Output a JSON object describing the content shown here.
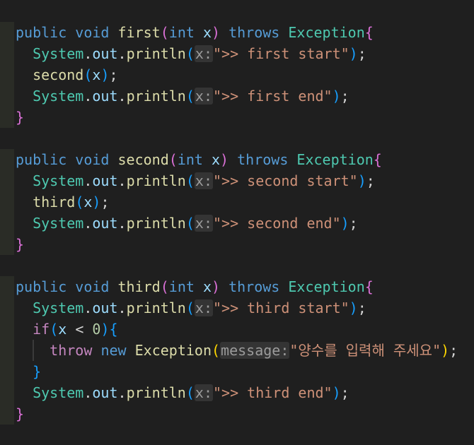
{
  "colors": {
    "background": "#1f1f1f",
    "keyword": "#569cd6",
    "function": "#dcdcaa",
    "variable": "#9cdcfe",
    "class": "#4ec9b0",
    "string": "#ce9178",
    "bracket1": "#da70d6",
    "bracket2": "#179fff",
    "bracket3": "#ffd700"
  },
  "lines": [
    {
      "guides": 0,
      "tokens": [
        {
          "t": "public",
          "c": "kw"
        },
        {
          "t": " "
        },
        {
          "t": "void",
          "c": "kw"
        },
        {
          "t": " "
        },
        {
          "t": "first",
          "c": "fn"
        },
        {
          "t": "(",
          "c": "p1"
        },
        {
          "t": "int",
          "c": "kw"
        },
        {
          "t": " "
        },
        {
          "t": "x",
          "c": "var"
        },
        {
          "t": ")",
          "c": "p1"
        },
        {
          "t": " "
        },
        {
          "t": "throws",
          "c": "kw"
        },
        {
          "t": " "
        },
        {
          "t": "Exception",
          "c": "cls"
        },
        {
          "t": "{",
          "c": "p1"
        }
      ]
    },
    {
      "guides": 0,
      "tokens": [
        {
          "t": "  "
        },
        {
          "t": "System",
          "c": "cls"
        },
        {
          "t": "."
        },
        {
          "t": "out",
          "c": "var"
        },
        {
          "t": "."
        },
        {
          "t": "println",
          "c": "fn"
        },
        {
          "t": "(",
          "c": "p2"
        },
        {
          "t": "x:",
          "c": "hint"
        },
        {
          "t": "\">> first start\"",
          "c": "str"
        },
        {
          "t": ")",
          "c": "p2"
        },
        {
          "t": ";"
        }
      ]
    },
    {
      "guides": 0,
      "tokens": [
        {
          "t": "  "
        },
        {
          "t": "second",
          "c": "fn"
        },
        {
          "t": "(",
          "c": "p2"
        },
        {
          "t": "x",
          "c": "var"
        },
        {
          "t": ")",
          "c": "p2"
        },
        {
          "t": ";"
        }
      ]
    },
    {
      "guides": 0,
      "tokens": [
        {
          "t": "  "
        },
        {
          "t": "System",
          "c": "cls"
        },
        {
          "t": "."
        },
        {
          "t": "out",
          "c": "var"
        },
        {
          "t": "."
        },
        {
          "t": "println",
          "c": "fn"
        },
        {
          "t": "(",
          "c": "p2"
        },
        {
          "t": "x:",
          "c": "hint"
        },
        {
          "t": "\">> first end\"",
          "c": "str"
        },
        {
          "t": ")",
          "c": "p2"
        },
        {
          "t": ";"
        }
      ]
    },
    {
      "guides": 0,
      "tokens": [
        {
          "t": "}",
          "c": "p1"
        }
      ]
    },
    {
      "guides": 0,
      "empty": true,
      "tokens": []
    },
    {
      "guides": 0,
      "tokens": [
        {
          "t": "public",
          "c": "kw"
        },
        {
          "t": " "
        },
        {
          "t": "void",
          "c": "kw"
        },
        {
          "t": " "
        },
        {
          "t": "second",
          "c": "fn"
        },
        {
          "t": "(",
          "c": "p1"
        },
        {
          "t": "int",
          "c": "kw"
        },
        {
          "t": " "
        },
        {
          "t": "x",
          "c": "var"
        },
        {
          "t": ")",
          "c": "p1"
        },
        {
          "t": " "
        },
        {
          "t": "throws",
          "c": "kw"
        },
        {
          "t": " "
        },
        {
          "t": "Exception",
          "c": "cls"
        },
        {
          "t": "{",
          "c": "p1"
        }
      ]
    },
    {
      "guides": 0,
      "tokens": [
        {
          "t": "  "
        },
        {
          "t": "System",
          "c": "cls"
        },
        {
          "t": "."
        },
        {
          "t": "out",
          "c": "var"
        },
        {
          "t": "."
        },
        {
          "t": "println",
          "c": "fn"
        },
        {
          "t": "(",
          "c": "p2"
        },
        {
          "t": "x:",
          "c": "hint"
        },
        {
          "t": "\">> second start\"",
          "c": "str"
        },
        {
          "t": ")",
          "c": "p2"
        },
        {
          "t": ";"
        }
      ]
    },
    {
      "guides": 0,
      "tokens": [
        {
          "t": "  "
        },
        {
          "t": "third",
          "c": "fn"
        },
        {
          "t": "(",
          "c": "p2"
        },
        {
          "t": "x",
          "c": "var"
        },
        {
          "t": ")",
          "c": "p2"
        },
        {
          "t": ";"
        }
      ]
    },
    {
      "guides": 0,
      "tokens": [
        {
          "t": "  "
        },
        {
          "t": "System",
          "c": "cls"
        },
        {
          "t": "."
        },
        {
          "t": "out",
          "c": "var"
        },
        {
          "t": "."
        },
        {
          "t": "println",
          "c": "fn"
        },
        {
          "t": "(",
          "c": "p2"
        },
        {
          "t": "x:",
          "c": "hint"
        },
        {
          "t": "\">> second end\"",
          "c": "str"
        },
        {
          "t": ")",
          "c": "p2"
        },
        {
          "t": ";"
        }
      ]
    },
    {
      "guides": 0,
      "tokens": [
        {
          "t": "}",
          "c": "p1"
        }
      ]
    },
    {
      "guides": 0,
      "empty": true,
      "tokens": []
    },
    {
      "guides": 0,
      "tokens": [
        {
          "t": "public",
          "c": "kw"
        },
        {
          "t": " "
        },
        {
          "t": "void",
          "c": "kw"
        },
        {
          "t": " "
        },
        {
          "t": "third",
          "c": "fn"
        },
        {
          "t": "(",
          "c": "p1"
        },
        {
          "t": "int",
          "c": "kw"
        },
        {
          "t": " "
        },
        {
          "t": "x",
          "c": "var"
        },
        {
          "t": ")",
          "c": "p1"
        },
        {
          "t": " "
        },
        {
          "t": "throws",
          "c": "kw"
        },
        {
          "t": " "
        },
        {
          "t": "Exception",
          "c": "cls"
        },
        {
          "t": "{",
          "c": "p1"
        }
      ]
    },
    {
      "guides": 0,
      "tokens": [
        {
          "t": "  "
        },
        {
          "t": "System",
          "c": "cls"
        },
        {
          "t": "."
        },
        {
          "t": "out",
          "c": "var"
        },
        {
          "t": "."
        },
        {
          "t": "println",
          "c": "fn"
        },
        {
          "t": "(",
          "c": "p2"
        },
        {
          "t": "x:",
          "c": "hint"
        },
        {
          "t": "\">> third start\"",
          "c": "str"
        },
        {
          "t": ")",
          "c": "p2"
        },
        {
          "t": ";"
        }
      ]
    },
    {
      "guides": 0,
      "tokens": [
        {
          "t": "  "
        },
        {
          "t": "if",
          "c": "kw2"
        },
        {
          "t": "(",
          "c": "p2"
        },
        {
          "t": "x",
          "c": "var"
        },
        {
          "t": " < "
        },
        {
          "t": "0",
          "c": "num"
        },
        {
          "t": ")",
          "c": "p2"
        },
        {
          "t": "{",
          "c": "p2"
        }
      ]
    },
    {
      "guides": 1,
      "tokens": [
        {
          "t": "    "
        },
        {
          "t": "throw",
          "c": "kw2"
        },
        {
          "t": " "
        },
        {
          "t": "new",
          "c": "kw"
        },
        {
          "t": " "
        },
        {
          "t": "Exception",
          "c": "fn"
        },
        {
          "t": "(",
          "c": "p3"
        },
        {
          "t": "message:",
          "c": "hint"
        },
        {
          "t": "\"양수를 입력해 주세요\"",
          "c": "str"
        },
        {
          "t": ")",
          "c": "p3"
        },
        {
          "t": ";"
        }
      ]
    },
    {
      "guides": 0,
      "tokens": [
        {
          "t": "  "
        },
        {
          "t": "}",
          "c": "p2"
        }
      ]
    },
    {
      "guides": 0,
      "tokens": [
        {
          "t": "  "
        },
        {
          "t": "System",
          "c": "cls"
        },
        {
          "t": "."
        },
        {
          "t": "out",
          "c": "var"
        },
        {
          "t": "."
        },
        {
          "t": "println",
          "c": "fn"
        },
        {
          "t": "(",
          "c": "p2"
        },
        {
          "t": "x:",
          "c": "hint"
        },
        {
          "t": "\">> third end\"",
          "c": "str"
        },
        {
          "t": ")",
          "c": "p2"
        },
        {
          "t": ";"
        }
      ]
    },
    {
      "guides": 0,
      "tokens": [
        {
          "t": "}",
          "c": "p1"
        }
      ]
    }
  ]
}
